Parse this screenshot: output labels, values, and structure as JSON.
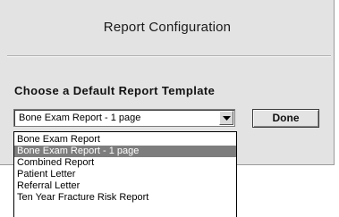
{
  "dialog": {
    "title": "Report Configuration",
    "template_label": "Choose a Default Report Template",
    "select": {
      "value": "Bone Exam Report - 1 page"
    },
    "done_label": "Done",
    "options": [
      {
        "label": "Bone Exam Report"
      },
      {
        "label": "Bone Exam Report - 1 page"
      },
      {
        "label": "Combined Report"
      },
      {
        "label": "Patient Letter"
      },
      {
        "label": "Referral Letter"
      },
      {
        "label": "Ten Year Fracture Risk Report"
      }
    ],
    "selected_index": 1,
    "colors": {
      "panel": "#e3e3e3",
      "highlight": "#7d7d7d"
    }
  }
}
